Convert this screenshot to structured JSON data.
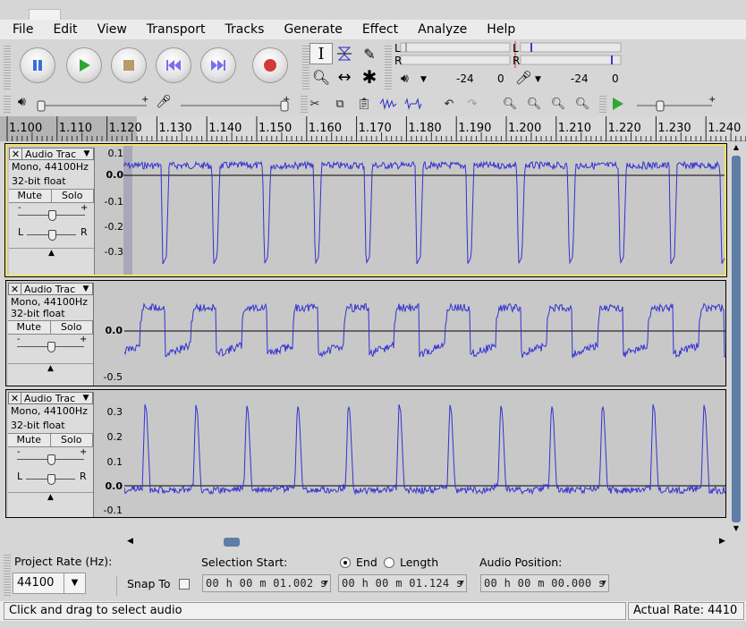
{
  "menu": [
    "File",
    "Edit",
    "View",
    "Transport",
    "Tracks",
    "Generate",
    "Effect",
    "Analyze",
    "Help"
  ],
  "meters": {
    "rec_l": "L",
    "rec_r": "R",
    "rec_db1": "-24",
    "rec_db2": "0",
    "play_l": "L",
    "play_r": "R",
    "play_db1": "-24",
    "play_db2": "0"
  },
  "ruler": {
    "labels": [
      "1.100",
      "1.110",
      "1.120",
      "1.130",
      "1.140",
      "1.150",
      "1.160",
      "1.170",
      "1.180",
      "1.190",
      "1.200",
      "1.210",
      "1.220",
      "1.230",
      "1.240"
    ]
  },
  "tracks": [
    {
      "name": "Audio Trac",
      "rate": "Mono, 44100Hz",
      "format": "32-bit float",
      "mute": "Mute",
      "solo": "Solo",
      "left": "L",
      "right": "R",
      "minus": "-",
      "plus": "+",
      "scale": [
        "0.1",
        "0.0",
        "-0.1",
        "-0.2",
        "-0.3"
      ]
    },
    {
      "name": "Audio Trac",
      "rate": "Mono, 44100Hz",
      "format": "32-bit float",
      "mute": "Mute",
      "solo": "Solo",
      "minus": "-",
      "plus": "+",
      "scale": [
        "0.0",
        "-0.5"
      ]
    },
    {
      "name": "Audio Trac",
      "rate": "Mono, 44100Hz",
      "format": "32-bit float",
      "mute": "Mute",
      "solo": "Solo",
      "left": "L",
      "right": "R",
      "minus": "-",
      "plus": "+",
      "scale": [
        "0.3",
        "0.2",
        "0.1",
        "0.0",
        "-0.1"
      ]
    }
  ],
  "bottom": {
    "project_rate_label": "Project Rate (Hz):",
    "project_rate": "44100",
    "snap_to": "Snap To",
    "selection_start_label": "Selection Start:",
    "end_label": "End",
    "length_label": "Length",
    "audio_position_label": "Audio Position:",
    "selection_start": "00 h 00 m 01.002 s",
    "selection_end": "00 h 00 m 01.124 s",
    "audio_position": "00 h 00 m 00.000 s"
  },
  "status": {
    "message": "Click and drag to select audio",
    "actual_rate": "Actual Rate: 4410"
  }
}
